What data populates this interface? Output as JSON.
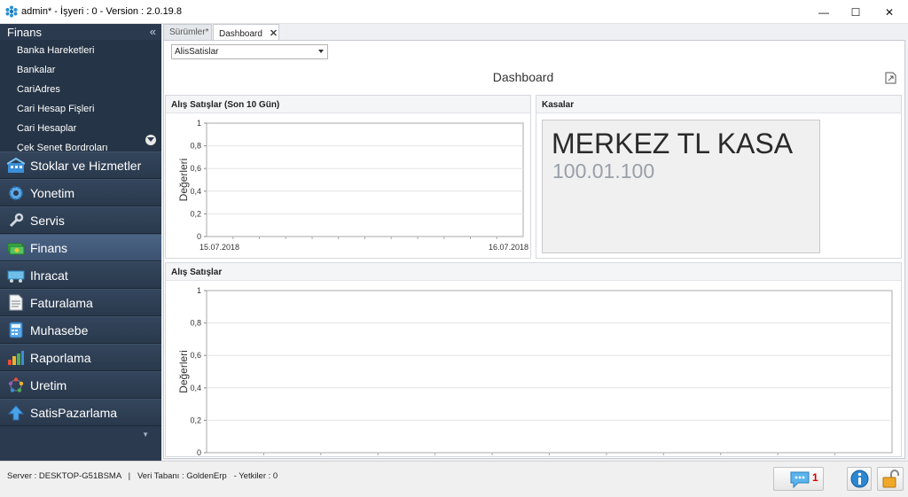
{
  "window": {
    "title": "admin* - İşyeri : 0 - Version : 2.0.19.8",
    "minimize": "—",
    "maximize": "☐",
    "close": "✕"
  },
  "sidebar": {
    "header": "Finans",
    "collapse_glyph": "«",
    "sub_items": [
      {
        "label": "Banka Hareketleri"
      },
      {
        "label": "Bankalar"
      },
      {
        "label": "CariAdres"
      },
      {
        "label": "Cari Hesap Fişleri"
      },
      {
        "label": "Cari Hesaplar"
      },
      {
        "label": "Çek Senet Bordroları"
      }
    ],
    "groups": [
      {
        "label": "Stoklar ve Hizmetler",
        "icon": "warehouse-icon"
      },
      {
        "label": "Yonetim",
        "icon": "gear-icon"
      },
      {
        "label": "Servis",
        "icon": "wrench-icon"
      },
      {
        "label": "Finans",
        "icon": "money-icon",
        "active": true
      },
      {
        "label": "Ihracat",
        "icon": "truck-icon"
      },
      {
        "label": "Faturalama",
        "icon": "invoice-icon"
      },
      {
        "label": "Muhasebe",
        "icon": "calculator-icon"
      },
      {
        "label": "Raporlama",
        "icon": "bar-chart-icon"
      },
      {
        "label": "Uretim",
        "icon": "production-icon"
      },
      {
        "label": "SatisPazarlama",
        "icon": "arrow-up-icon"
      }
    ]
  },
  "tabs": [
    {
      "label": "Sürümler*"
    },
    {
      "label": "Dashboard",
      "active": true,
      "close": "✕"
    }
  ],
  "dashboard": {
    "combo_value": "AlisSatislar",
    "title": "Dashboard",
    "panel_chart_small": {
      "title": "Alış Satışlar (Son 10 Gün)"
    },
    "panel_kasalar": {
      "title": "Kasalar",
      "kasa_name": "MERKEZ TL KASA",
      "kasa_code": "100.01.100"
    },
    "panel_chart_big": {
      "title": "Alış Satışlar"
    }
  },
  "chart_data": [
    {
      "type": "line",
      "title": "Alış Satışlar (Son 10 Gün)",
      "ylabel": "Değerleri",
      "xlabel": "",
      "x": [
        "15.07.2018",
        "16.07.2018"
      ],
      "ylim": [
        0,
        1
      ],
      "yticks": [
        "0",
        "0,2",
        "0,4",
        "0,6",
        "0,8",
        "1"
      ],
      "series": [],
      "grid": true
    },
    {
      "type": "line",
      "title": "Alış Satışlar",
      "ylabel": "Değerleri",
      "xlabel": "",
      "x": [],
      "ylim": [
        0,
        1
      ],
      "yticks": [
        "0",
        "0,2",
        "0,4",
        "0,6",
        "0,8",
        "1"
      ],
      "series": [],
      "grid": true
    }
  ],
  "statusbar": {
    "text": "Server : DESKTOP-G51BSMA   |   Veri Tabanı : GoldenErp   - Yetkiler : 0",
    "notification_count": "1"
  },
  "colors": {
    "sidebar_bg": "#2b3a4e",
    "accent_blue": "#3c5272",
    "badge_red": "#d90000"
  }
}
